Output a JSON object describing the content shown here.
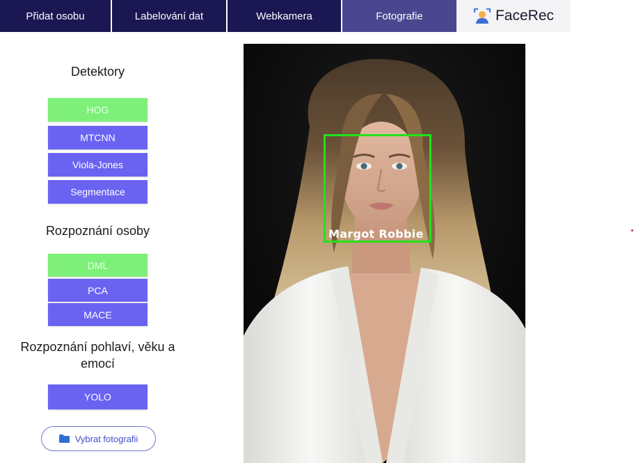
{
  "nav": {
    "tabs": [
      {
        "label": "Přidat osobu"
      },
      {
        "label": "Labelování dat"
      },
      {
        "label": "Webkamera"
      },
      {
        "label": "Fotografie",
        "active": true
      }
    ],
    "brand": "FaceRec"
  },
  "sidebar": {
    "detectors": {
      "title": "Detektory",
      "buttons": [
        {
          "label": "HOG",
          "selected": true
        },
        {
          "label": "MTCNN"
        },
        {
          "label": "Viola-Jones"
        },
        {
          "label": "Segmentace"
        }
      ]
    },
    "recognition": {
      "title": "Rozpoznání osoby",
      "buttons": [
        {
          "label": "DML",
          "selected": true
        },
        {
          "label": "PCA"
        },
        {
          "label": "MACE"
        }
      ]
    },
    "attributes": {
      "title_line1": "Rozpoznání pohlaví, věku a",
      "title_line2": "emocí",
      "buttons": [
        {
          "label": "YOLO"
        }
      ]
    },
    "upload_button": "Vybrat fotografii"
  },
  "photo": {
    "detected_name": "Margot Robbie"
  },
  "colors": {
    "nav_bg": "#1a1753",
    "nav_active": "#4a4690",
    "button_blue": "#6a63f2",
    "button_selected": "#7ef07a",
    "face_box": "#21e21b"
  }
}
